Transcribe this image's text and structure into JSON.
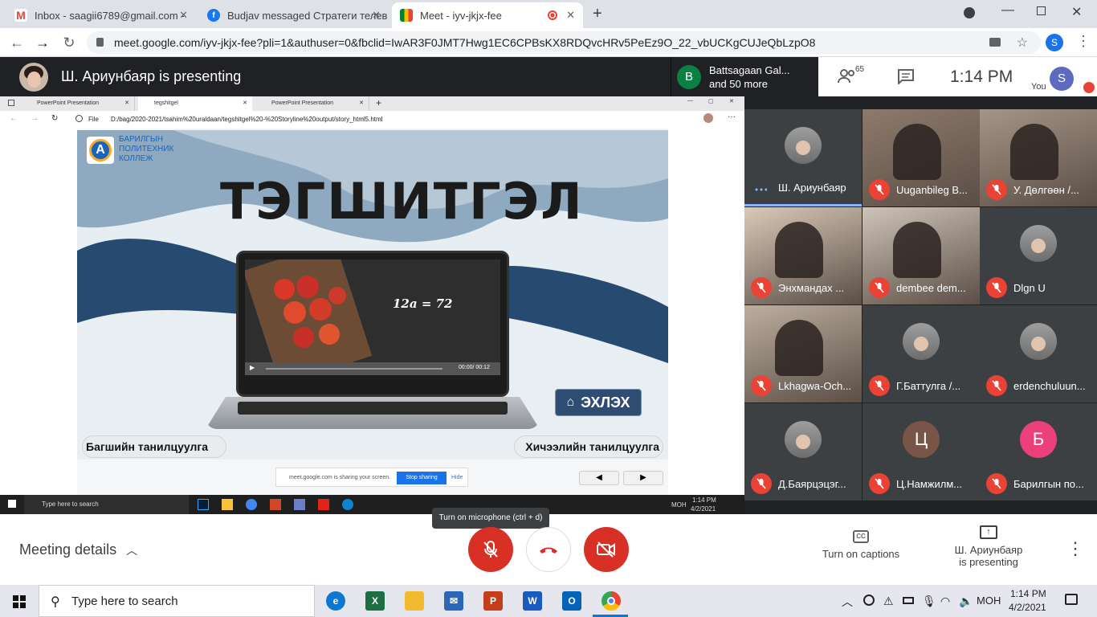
{
  "browser": {
    "tabs": [
      {
        "label": "Inbox - saagii6789@gmail.com -",
        "icon": "gmail-icon"
      },
      {
        "label": "Budjav messaged Стратеги телев",
        "icon": "facebook-icon"
      },
      {
        "label": "Meet - iyv-jkjx-fee",
        "icon": "meet-icon"
      }
    ],
    "url": "meet.google.com/iyv-jkjx-fee?pli=1&authuser=0&fbclid=IwAR3F0JMT7Hwg1EC6CPBsKX8RDQvcHRv5PeEz9O_22_vbUCKgCUJeQbLzpO8",
    "profile_initial": "S"
  },
  "meet": {
    "presenting_banner": "Ш. Ариунбаяр is presenting",
    "notification": {
      "initial": "B",
      "line1": "Battsagaan Gal...",
      "line2": "and 50 more"
    },
    "participants_count": "65",
    "time": "1:14 PM",
    "you_label": "You",
    "you_initial": "S",
    "mic_tooltip": "Turn on microphone (ctrl + d)",
    "meeting_details": "Meeting details",
    "captions_label": "Turn on captions",
    "presenting_line1": "Ш. Ариунбаяр",
    "presenting_line2": "is presenting"
  },
  "shared_screen": {
    "edge_tabs": [
      "PowerPoint Presentation",
      "tegshitgel",
      "PowerPoint Presentation"
    ],
    "file_label": "File",
    "path": "D:/bag/2020-2021/tsahim%20uraldaan/tegshitgel%20-%20Storyline%20output/story_html5.html",
    "college_line1": "БАРИЛГЫН",
    "college_line2": "ПОЛИТЕХНИК",
    "college_line3": "КОЛЛЕЖ",
    "slide_title": "ТЭГШИТГЭЛ",
    "equation": "12a = 72",
    "video_time": "00:00/ 00:12",
    "start_button": "ЭХЛЭХ",
    "left_label": "Багшийн танилцуулга",
    "right_label": "Хичээлийн танилцуулга",
    "sharing_msg": "meet.google.com is sharing your screen.",
    "stop_sharing": "Stop sharing",
    "hide": "Hide",
    "inner_search": "Type here to search",
    "inner_lang": "MOH",
    "inner_time": "1:14 PM",
    "inner_date": "4/2/2021"
  },
  "participants": [
    {
      "name": "Ш. Ариунбаяр",
      "type": "avatar",
      "speaking": true
    },
    {
      "name": "Uuganbileg B...",
      "type": "video"
    },
    {
      "name": "У. Дөлгөөн /...",
      "type": "video"
    },
    {
      "name": "Энхмандах ...",
      "type": "video"
    },
    {
      "name": "dembee dem...",
      "type": "video"
    },
    {
      "name": "Dlgn U",
      "type": "avatar"
    },
    {
      "name": "Lkhagwa-Och...",
      "type": "video"
    },
    {
      "name": "Г.Баттулга /...",
      "type": "avatar"
    },
    {
      "name": "erdenchuluun...",
      "type": "avatar"
    },
    {
      "name": "Д.Баярцэцэг...",
      "type": "avatar"
    },
    {
      "name": "Ц.Намжилм...",
      "type": "letter",
      "initial": "Ц",
      "color": "#795548"
    },
    {
      "name": "Барилгын по...",
      "type": "letter",
      "initial": "Б",
      "color": "#ec407a"
    }
  ],
  "taskbar": {
    "search": "Type here to search",
    "lang": "МОН",
    "time": "1:14 PM",
    "date": "4/2/2021"
  },
  "colors": {
    "red": "#ea4335",
    "meet_dark": "#202124",
    "tile": "#3c4043",
    "blue": "#1a73e8"
  }
}
